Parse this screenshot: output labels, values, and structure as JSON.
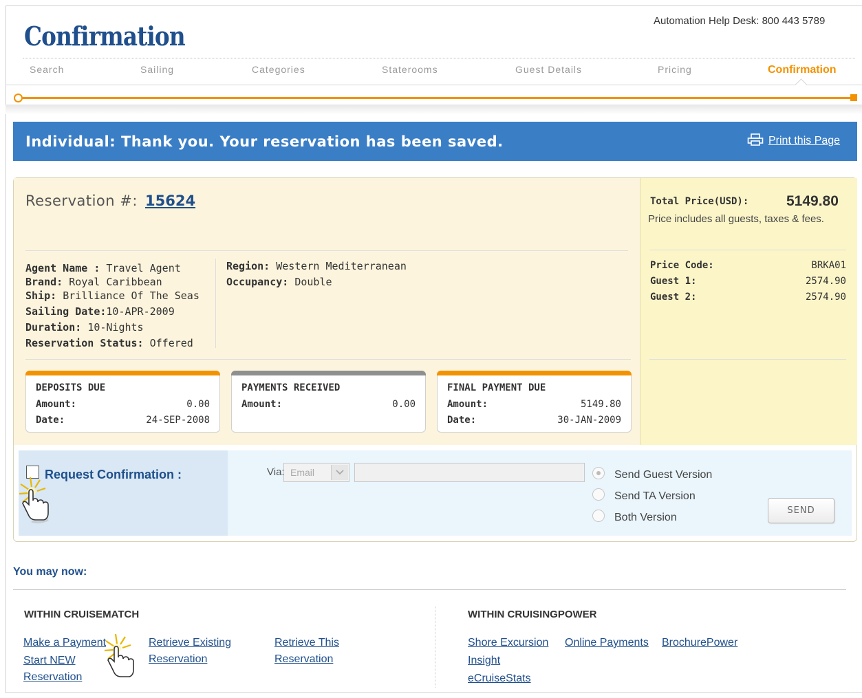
{
  "page": {
    "title": "Confirmation",
    "help_desk": "Automation Help Desk: 800 443 5789"
  },
  "steps": [
    "Search",
    "Sailing",
    "Categories",
    "Staterooms",
    "Guest Details",
    "Pricing",
    "Confirmation"
  ],
  "active_step": "Confirmation",
  "banner": {
    "message": "Individual: Thank you. Your reservation has been saved.",
    "print_link": "Print this Page"
  },
  "reservation": {
    "label": "Reservation #:",
    "number": "15624",
    "details_left": [
      {
        "key": "Agent Name :",
        "value": "Travel Agent"
      },
      {
        "key": "Brand:",
        "value": "Royal Caribbean"
      },
      {
        "key": "Ship:",
        "value": "Brilliance Of The Seas"
      },
      {
        "key": "Sailing Date:",
        "value": "10-APR-2009"
      },
      {
        "key": "Duration:",
        "value": "10-Nights"
      },
      {
        "key": "Reservation Status:",
        "value": "Offered"
      }
    ],
    "details_right": [
      {
        "key": "Region:",
        "value": "Western Mediterranean"
      },
      {
        "key": "Occupancy:",
        "value": "Double"
      }
    ]
  },
  "cards": [
    {
      "title": "DEPOSITS DUE",
      "bar_color": "#f39200",
      "rows": [
        {
          "key": "Amount:",
          "value": "0.00"
        },
        {
          "key": "Date:",
          "value": "24-SEP-2008"
        }
      ]
    },
    {
      "title": "PAYMENTS RECEIVED",
      "bar_color": "#8f8f8f",
      "rows": [
        {
          "key": "Amount:",
          "value": "0.00"
        }
      ]
    },
    {
      "title": "FINAL PAYMENT DUE",
      "bar_color": "#f39200",
      "rows": [
        {
          "key": "Amount:",
          "value": "5149.80"
        },
        {
          "key": "Date:",
          "value": "30-JAN-2009"
        }
      ]
    }
  ],
  "pricing": {
    "total_label": "Total Price(USD):",
    "total_value": "5149.80",
    "note": "Price includes all guests, taxes & fees.",
    "rows": [
      {
        "key": "Price Code:",
        "value": "BRKA01"
      },
      {
        "key": "Guest 1:",
        "value": "2574.90"
      },
      {
        "key": "Guest 2:",
        "value": "2574.90"
      }
    ]
  },
  "request": {
    "label": "Request Confirmation :",
    "checked": false,
    "via_label": "Via:",
    "via_selected": "Email",
    "email_value": "",
    "options": [
      "Send Guest Version",
      "Send TA Version",
      "Both Version"
    ],
    "selected_option": "Send Guest Version",
    "send_label": "SEND"
  },
  "next_steps": {
    "heading": "You may now:",
    "cruisematch": {
      "title": "WITHIN CRUISEMATCH",
      "links": [
        "Make a Payment",
        "Start NEW Reservation",
        "Retrieve Existing Reservation",
        "Retrieve This Reservation"
      ]
    },
    "cruisingpower": {
      "title": "WITHIN CRUISINGPOWER",
      "links": [
        "Shore Excursion",
        "Online Payments",
        "BrochurePower",
        "Insight",
        "eCruiseStats"
      ]
    }
  },
  "colors": {
    "brand_blue": "#1f4f8c",
    "accent_orange": "#f39200",
    "banner_blue": "#3a7ec6"
  },
  "icons": [
    "printer-icon",
    "chevron-down-icon",
    "pointer-hand-icon"
  ]
}
